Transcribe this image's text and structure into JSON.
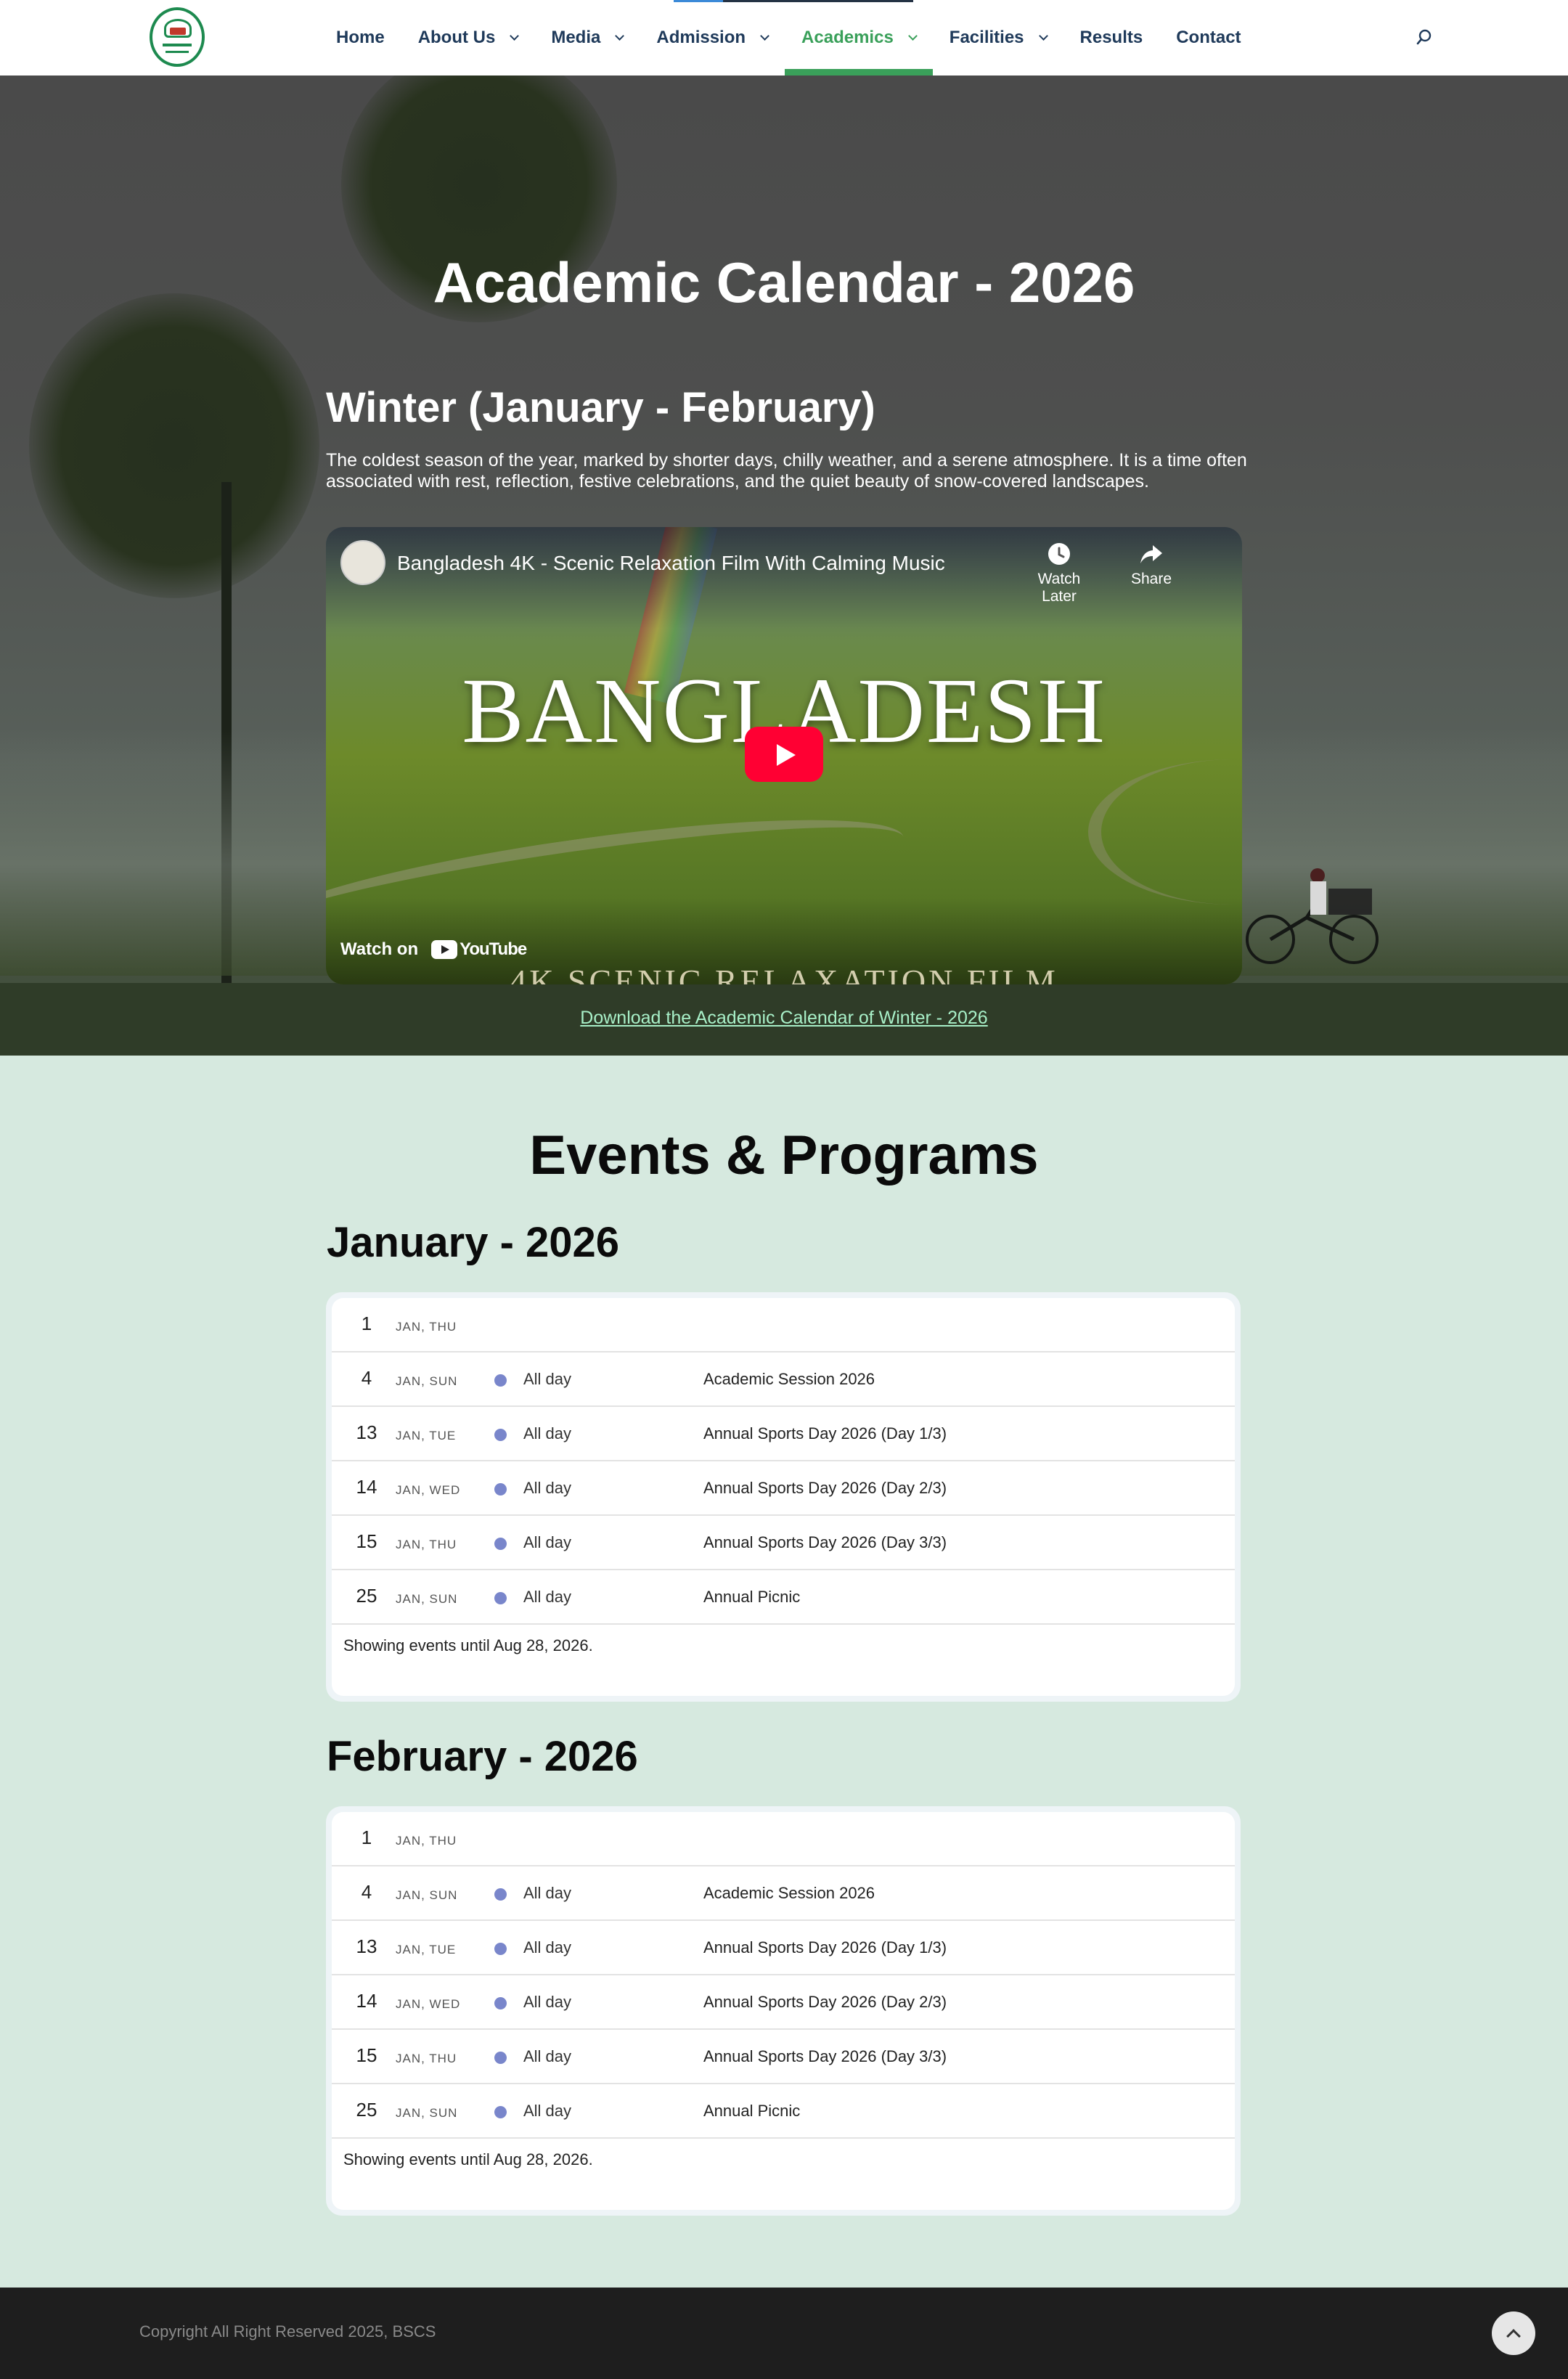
{
  "nav": {
    "items": [
      {
        "label": "Home",
        "dropdown": false,
        "active": false
      },
      {
        "label": "About Us",
        "dropdown": true,
        "active": false
      },
      {
        "label": "Media",
        "dropdown": true,
        "active": false
      },
      {
        "label": "Admission",
        "dropdown": true,
        "active": false
      },
      {
        "label": "Academics",
        "dropdown": true,
        "active": true
      },
      {
        "label": "Facilities",
        "dropdown": true,
        "active": false
      },
      {
        "label": "Results",
        "dropdown": false,
        "active": false
      },
      {
        "label": "Contact",
        "dropdown": false,
        "active": false
      }
    ],
    "search_icon": "search-icon"
  },
  "hero": {
    "title": "Academic Calendar - 2026",
    "season_title": "Winter (January - February)",
    "season_desc": "The coldest season of the year, marked by shorter days, chilly weather, and a serene atmosphere. It is a time often associated with rest, reflection, festive celebrations, and the quiet beauty of snow-covered landscapes.",
    "video": {
      "title": "Bangladesh 4K - Scenic Relaxation Film With Calming Music",
      "watch_later": "Watch Later",
      "share": "Share",
      "watch_on": "Watch on",
      "youtube": "YouTube",
      "thumb_word": "BANGLADESH",
      "thumb_sub": "4K SCENIC RELAXATION FILM"
    },
    "download_link": "Download the Academic Calendar of Winter - 2026"
  },
  "events": {
    "title": "Events & Programs",
    "months": [
      {
        "title": "January - 2026",
        "rows": [
          {
            "day": "1",
            "dow": "JAN, THU",
            "time": "",
            "event": ""
          },
          {
            "day": "4",
            "dow": "JAN, SUN",
            "time": "All day",
            "event": "Academic Session 2026"
          },
          {
            "day": "13",
            "dow": "JAN, TUE",
            "time": "All day",
            "event": "Annual Sports Day 2026 (Day 1/3)"
          },
          {
            "day": "14",
            "dow": "JAN, WED",
            "time": "All day",
            "event": "Annual Sports Day 2026 (Day 2/3)"
          },
          {
            "day": "15",
            "dow": "JAN, THU",
            "time": "All day",
            "event": "Annual Sports Day 2026 (Day 3/3)"
          },
          {
            "day": "25",
            "dow": "JAN, SUN",
            "time": "All day",
            "event": "Annual Picnic"
          }
        ],
        "footer": "Showing events until Aug 28, 2026."
      },
      {
        "title": "February - 2026",
        "rows": [
          {
            "day": "1",
            "dow": "JAN, THU",
            "time": "",
            "event": ""
          },
          {
            "day": "4",
            "dow": "JAN, SUN",
            "time": "All day",
            "event": "Academic Session 2026"
          },
          {
            "day": "13",
            "dow": "JAN, TUE",
            "time": "All day",
            "event": "Annual Sports Day 2026 (Day 1/3)"
          },
          {
            "day": "14",
            "dow": "JAN, WED",
            "time": "All day",
            "event": "Annual Sports Day 2026 (Day 2/3)"
          },
          {
            "day": "15",
            "dow": "JAN, THU",
            "time": "All day",
            "event": "Annual Sports Day 2026 (Day 3/3)"
          },
          {
            "day": "25",
            "dow": "JAN, SUN",
            "time": "All day",
            "event": "Annual Picnic"
          }
        ],
        "footer": "Showing events until Aug 28, 2026."
      }
    ],
    "event_dot_color": "#7986cb"
  },
  "footer": {
    "copyright": "Copyright All Right Reserved 2025, BSCS",
    "to_top_icon": "chevron-up-icon"
  },
  "colors": {
    "accent": "#3aa05a",
    "nav_text": "#1f3a5a",
    "events_bg": "#d6e9df",
    "footer_bg": "#1e1e1e"
  }
}
